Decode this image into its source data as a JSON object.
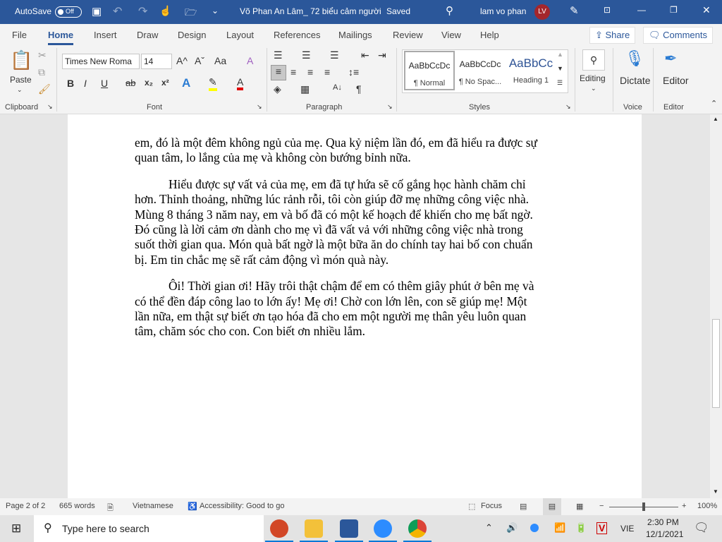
{
  "titlebar": {
    "autosave": "AutoSave",
    "autosave_state": "Off",
    "title": "Võ Phan An Lâm_ 72 biểu cảm người",
    "saved": "Saved",
    "user": "lam vo phan",
    "initials": "LV"
  },
  "tabs": [
    "File",
    "Home",
    "Insert",
    "Draw",
    "Design",
    "Layout",
    "References",
    "Mailings",
    "Review",
    "View",
    "Help"
  ],
  "share": "Share",
  "comments": "Comments",
  "ribbon": {
    "clipboard": {
      "label": "Clipboard",
      "paste": "Paste"
    },
    "font": {
      "label": "Font",
      "name": "Times New Roma",
      "size": "14",
      "bold": "B",
      "italic": "I",
      "underline": "U",
      "strike": "ab",
      "sub": "x₂",
      "sup": "x²",
      "grow": "A^",
      "shrink": "Aˇ",
      "case": "Aa"
    },
    "paragraph": {
      "label": "Paragraph",
      "pilcrow": "¶"
    },
    "styles": {
      "label": "Styles",
      "items": [
        {
          "preview": "AaBbCcDc",
          "name": "¶ Normal"
        },
        {
          "preview": "AaBbCcDc",
          "name": "¶ No Spac..."
        },
        {
          "preview": "AaBbCc",
          "name": "Heading 1"
        }
      ]
    },
    "editing": "Editing",
    "dictate": "Dictate",
    "voice": "Voice",
    "editor": "Editor",
    "editor_group": "Editor"
  },
  "document": {
    "paragraphs": [
      {
        "indent": false,
        "lines": [
          "em, đó là một đêm không ngủ của mẹ. Qua kỷ niệm lần đó, em đã hiểu ra được sự",
          "quan tâm, lo lắng của mẹ và không còn bướng bỉnh nữa."
        ]
      },
      {
        "indent": true,
        "lines": [
          "Hiểu được sự vất vả của mẹ, em đã tự hứa sẽ cố gắng học hành chăm chỉ",
          "hơn. Thỉnh thoảng, những lúc rảnh rỗi, tôi còn giúp đỡ mẹ những công việc nhà.",
          "Mùng 8 tháng 3 năm nay, em  và bố đã có một kế hoạch để khiến cho mẹ bất ngờ.",
          "Đó cũng là lời cảm ơn dành cho mẹ vì đã vất vả với những công việc nhà trong",
          "suốt thời gian qua. Món quà bất ngờ là một bữa ăn do chính tay hai bố con chuẩn",
          "bị. Em tin chắc mẹ sẽ rất cảm động vì món quà này."
        ]
      },
      {
        "indent": true,
        "lines": [
          "Ôi! Thời gian ơi! Hãy trôi thật chậm để em có thêm giây phút ở bên mẹ và",
          "có thể đền đáp công lao to lớn ấy! Mẹ ơi! Chờ con lớn lên, con sẽ giúp mẹ! Một",
          "lần nữa, em thật sự biết ơn tạo hóa đã cho em một người mẹ thân yêu luôn quan",
          "tâm, chăm sóc cho con. Con biết ơn nhiều lắm."
        ]
      }
    ]
  },
  "status": {
    "page": "Page 2 of 2",
    "words": "665 words",
    "language": "Vietnamese",
    "accessibility": "Accessibility: Good to go",
    "focus": "Focus",
    "zoom": "100%",
    "zoom_percent": 100
  },
  "taskbar": {
    "search_placeholder": "Type here to search",
    "lang": "VIE",
    "time": "2:30 PM",
    "date": "12/1/2021"
  },
  "colors": {
    "brand": "#2b579a",
    "avatar": "#a4262c"
  }
}
